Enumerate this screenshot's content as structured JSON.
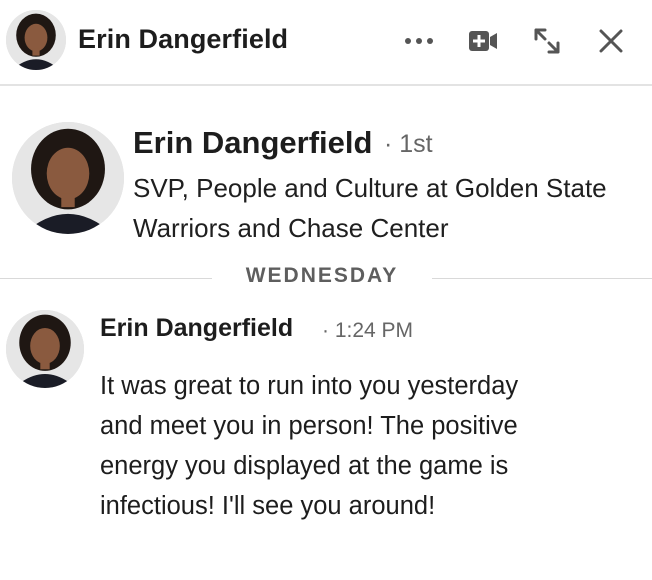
{
  "header": {
    "name": "Erin Dangerfield",
    "icons": {
      "more": "more-horizontal-icon",
      "video": "video-call-icon",
      "expand": "expand-icon",
      "close": "close-icon"
    }
  },
  "profile": {
    "name": "Erin Dangerfield",
    "degree": "· 1st",
    "headline": "SVP, People and Culture at Golden State Warriors and Chase Center"
  },
  "divider": {
    "label": "WEDNESDAY"
  },
  "message": {
    "sender": "Erin Dangerfield",
    "time": "· 1:24 PM",
    "body": "It was great to run into you yesterday and meet you in person! The positive energy you displayed at the game is infectious! I'll see you around!"
  }
}
